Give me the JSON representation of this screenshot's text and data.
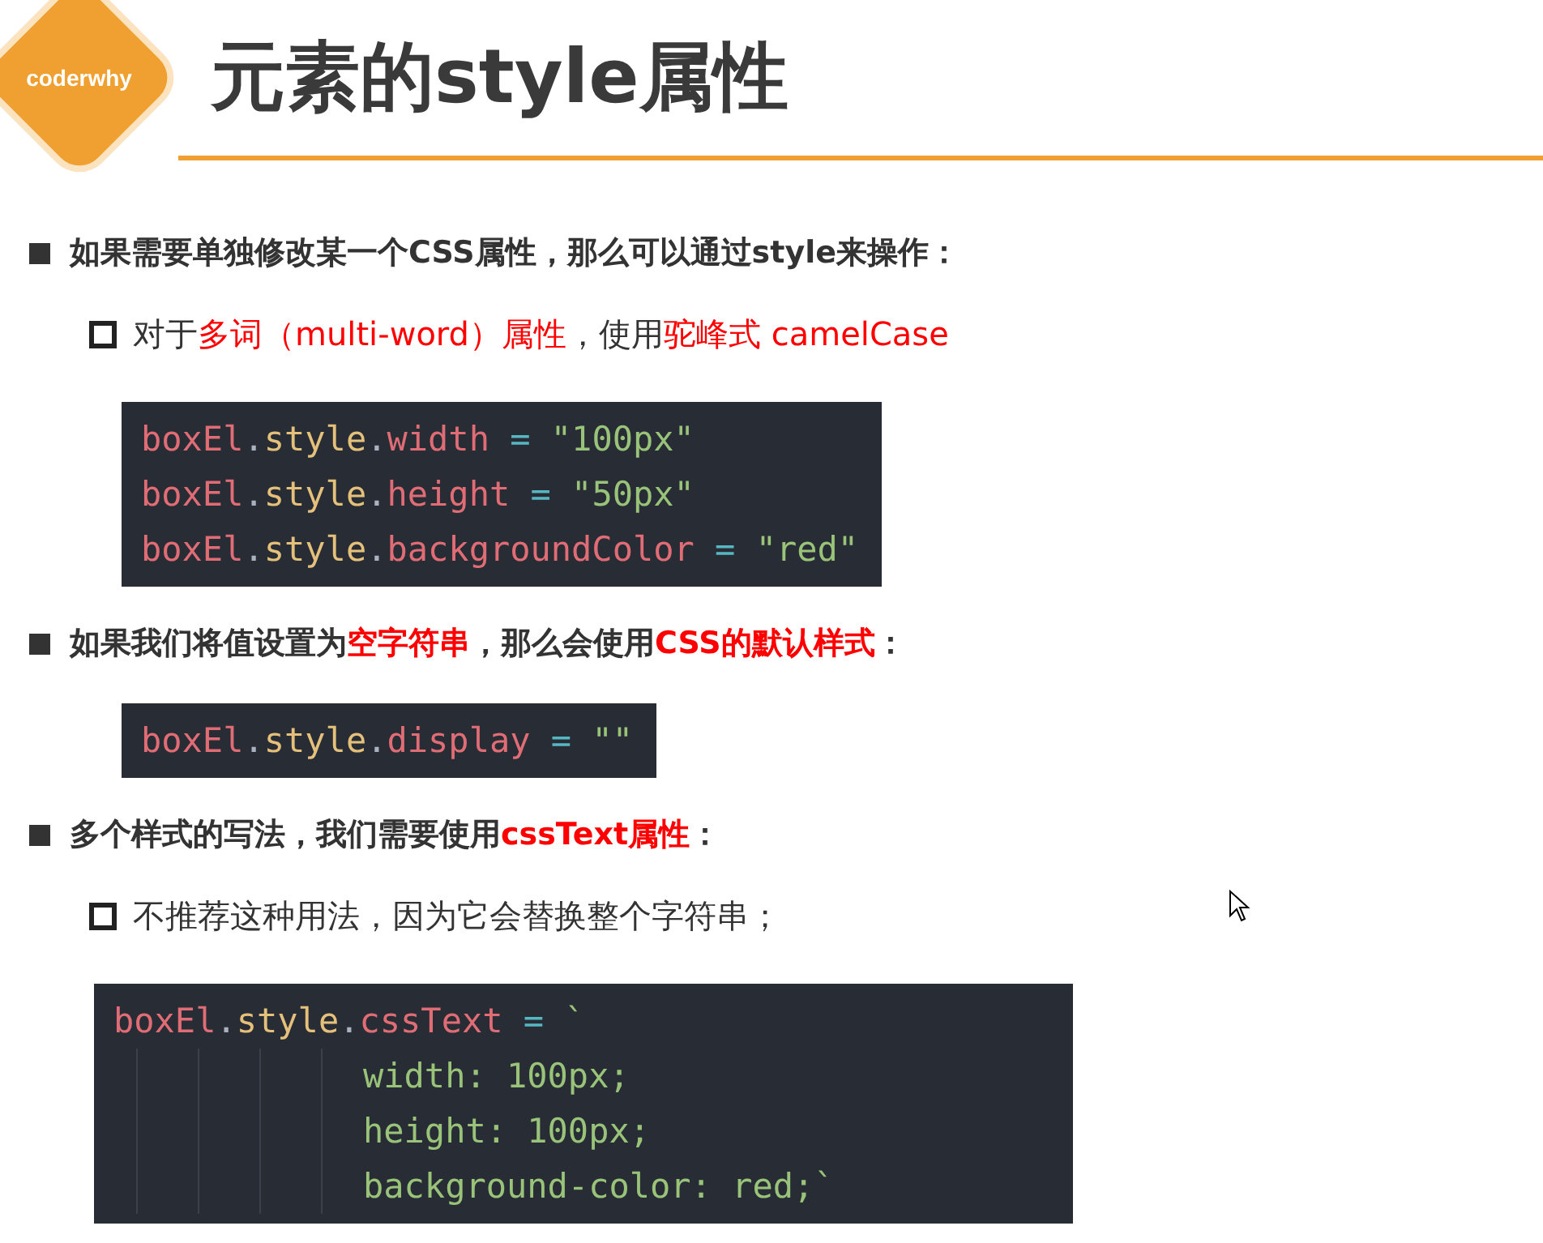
{
  "logo": {
    "text": "coderwhy"
  },
  "title": "元素的style属性",
  "items": [
    {
      "kind": "bullet",
      "segments": [
        {
          "text": "如果需要单独修改某一个CSS属性，那么可以通过style来操作：",
          "red": false
        }
      ]
    },
    {
      "kind": "sub",
      "segments": [
        {
          "text": "对于",
          "red": false
        },
        {
          "text": "多词（multi-word）属性",
          "red": true
        },
        {
          "text": "，使用",
          "red": false
        },
        {
          "text": "驼峰式 camelCase",
          "red": true
        }
      ]
    },
    {
      "kind": "code",
      "lines": [
        {
          "indented": false,
          "tokens": [
            {
              "kind": "ident",
              "text": "boxEl"
            },
            {
              "kind": "punct",
              "text": "."
            },
            {
              "kind": "prop",
              "text": "style"
            },
            {
              "kind": "punct",
              "text": "."
            },
            {
              "kind": "ident",
              "text": "width"
            },
            {
              "kind": "op",
              "text": " = "
            },
            {
              "kind": "string",
              "text": "\"100px\""
            }
          ]
        },
        {
          "indented": false,
          "tokens": [
            {
              "kind": "ident",
              "text": "boxEl"
            },
            {
              "kind": "punct",
              "text": "."
            },
            {
              "kind": "prop",
              "text": "style"
            },
            {
              "kind": "punct",
              "text": "."
            },
            {
              "kind": "ident",
              "text": "height"
            },
            {
              "kind": "op",
              "text": " = "
            },
            {
              "kind": "string",
              "text": "\"50px\""
            }
          ]
        },
        {
          "indented": false,
          "tokens": [
            {
              "kind": "ident",
              "text": "boxEl"
            },
            {
              "kind": "punct",
              "text": "."
            },
            {
              "kind": "prop",
              "text": "style"
            },
            {
              "kind": "punct",
              "text": "."
            },
            {
              "kind": "ident",
              "text": "backgroundColor"
            },
            {
              "kind": "op",
              "text": " = "
            },
            {
              "kind": "string",
              "text": "\"red\""
            }
          ]
        }
      ]
    },
    {
      "kind": "bullet",
      "segments": [
        {
          "text": "如果我们将值设置为",
          "red": false
        },
        {
          "text": "空字符串",
          "red": true
        },
        {
          "text": "，那么会使用",
          "red": false
        },
        {
          "text": "CSS的默认样式",
          "red": true
        },
        {
          "text": "：",
          "red": false
        }
      ]
    },
    {
      "kind": "code",
      "lines": [
        {
          "indented": false,
          "tokens": [
            {
              "kind": "ident",
              "text": "boxEl"
            },
            {
              "kind": "punct",
              "text": "."
            },
            {
              "kind": "prop",
              "text": "style"
            },
            {
              "kind": "punct",
              "text": "."
            },
            {
              "kind": "ident",
              "text": "display"
            },
            {
              "kind": "op",
              "text": " = "
            },
            {
              "kind": "string",
              "text": "\"\""
            }
          ]
        }
      ]
    },
    {
      "kind": "bullet",
      "segments": [
        {
          "text": "多个样式的写法，我们需要使用",
          "red": false
        },
        {
          "text": "cssText属性",
          "red": true
        },
        {
          "text": "：",
          "red": false
        }
      ]
    },
    {
      "kind": "sub",
      "segments": [
        {
          "text": "不推荐这种用法，因为它会替换整个字符串；",
          "red": false
        }
      ]
    },
    {
      "kind": "code",
      "lines": [
        {
          "indented": false,
          "tokens": [
            {
              "kind": "ident",
              "text": "boxEl"
            },
            {
              "kind": "punct",
              "text": "."
            },
            {
              "kind": "prop",
              "text": "style"
            },
            {
              "kind": "punct",
              "text": "."
            },
            {
              "kind": "ident",
              "text": "cssText"
            },
            {
              "kind": "op",
              "text": " = "
            },
            {
              "kind": "string",
              "text": "`"
            }
          ]
        },
        {
          "indented": true,
          "tokens": [
            {
              "kind": "string",
              "text": "width: 100px;"
            }
          ]
        },
        {
          "indented": true,
          "tokens": [
            {
              "kind": "string",
              "text": "height: 100px;"
            }
          ]
        },
        {
          "indented": true,
          "tokens": [
            {
              "kind": "string",
              "text": "background-color: red;`"
            }
          ]
        }
      ]
    }
  ]
}
